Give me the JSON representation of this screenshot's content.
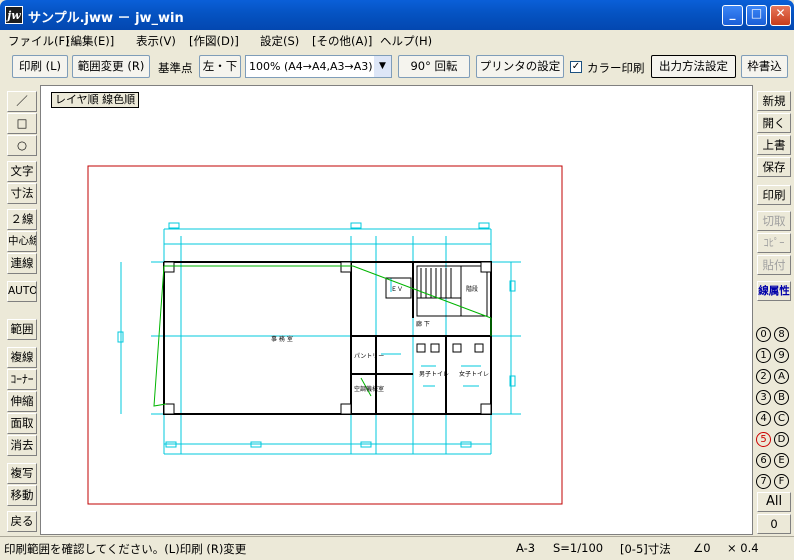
{
  "window": {
    "title": "サンプル.jww － jw_win",
    "icon_text": "jw",
    "minimize": "_",
    "maximize": "□",
    "close": "✕"
  },
  "menu": [
    "ファイル(F)",
    "[編集(E)]",
    "表示(V)",
    "[作図(D)]",
    "設定(S)",
    "[その他(A)]",
    "ヘルプ(H)"
  ],
  "toolbar": {
    "print": "印刷 (L)",
    "range_change": "範囲変更 (R)",
    "base_point_label": "基準点",
    "base_point_value": "左・下",
    "scale_select": "100% (A4→A4,A3→A3)",
    "rotate": "90° 回転",
    "printer_settings": "プリンタの設定",
    "color_print_label": "カラー印刷",
    "color_print_checked": "✓",
    "output_settings": "出力方法設定",
    "frame_write": "枠書込"
  },
  "left_tools": [
    "／",
    "□",
    "○",
    "文字",
    "寸法",
    "２線",
    "中心線",
    "連線",
    "AUTO",
    "範囲",
    "複線",
    "ｺｰﾅｰ",
    "伸縮",
    "面取",
    "消去",
    "複写",
    "移動",
    "戻る"
  ],
  "right_tools": [
    "新規",
    "開く",
    "上書",
    "保存",
    "印刷",
    "切取",
    "ｺﾋﾟｰ",
    "貼付",
    "線属性"
  ],
  "layers_left": [
    "0",
    "1",
    "2",
    "3",
    "4",
    "5",
    "6",
    "7"
  ],
  "layers_right": [
    "8",
    "9",
    "A",
    "B",
    "C",
    "D",
    "E",
    "F"
  ],
  "layer_all": "All",
  "layer_zero": "0",
  "canvas": {
    "layer_order_label": "レイヤ順 線色順",
    "room_labels": {
      "office": "事 務 室",
      "ev": "ＥＶ",
      "corridor": "廊 下",
      "pantry": "パントリー",
      "mech_room": "空調機械室",
      "stair": "階段",
      "toilet_m": "男子トイレ",
      "toilet_f": "女子トイレ"
    }
  },
  "status": {
    "message": "印刷範囲を確認してください。(L)印刷 (R)変更",
    "paper": "A-3",
    "scale": "S=1/100",
    "dim_mode": "[0-5]寸法",
    "angle": "∠0",
    "factor": "× 0.4"
  },
  "colors": {
    "title_blue": "#0553c2",
    "print_frame": "#c00000",
    "wall_line": "#000000",
    "dim_line": "#00c8dc",
    "slab_line": "#00b400"
  }
}
